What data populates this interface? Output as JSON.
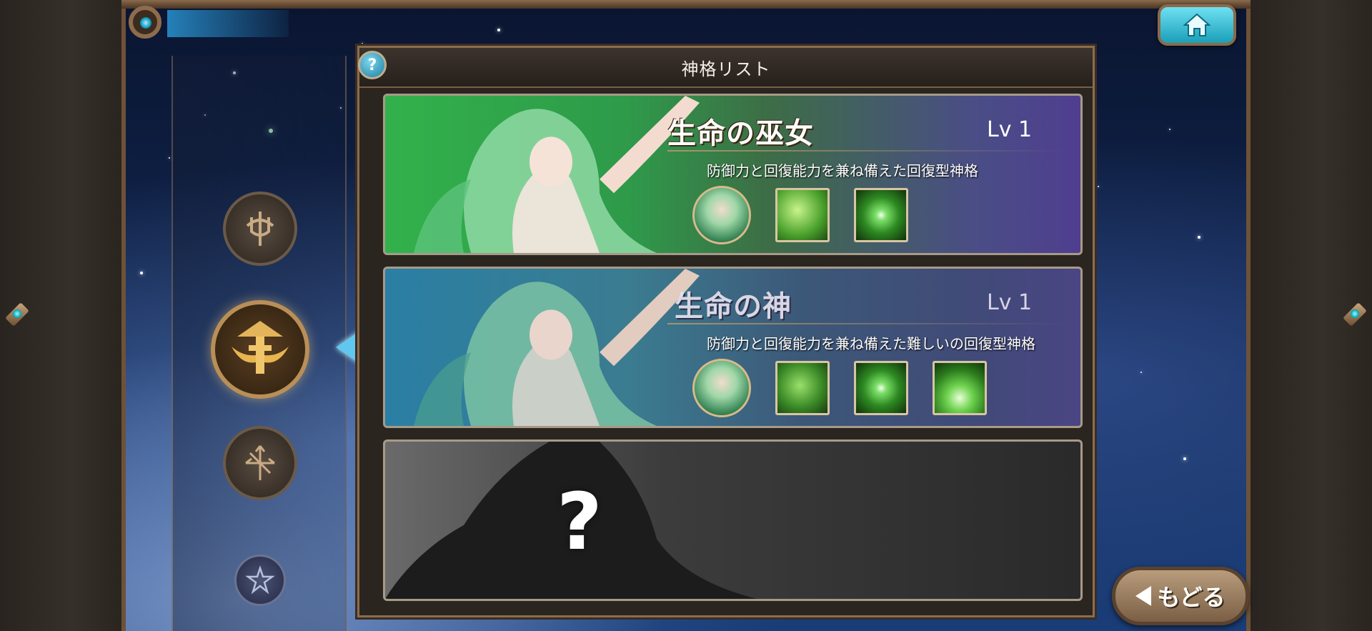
{
  "screen": {
    "title": "神格リスト",
    "help_label": "?"
  },
  "header": {
    "home_icon": "home-icon"
  },
  "nav": {
    "items": [
      {
        "icon": "trident-emblem-icon",
        "active": false
      },
      {
        "icon": "winged-cross-emblem-icon",
        "active": true
      },
      {
        "icon": "arrows-emblem-icon",
        "active": false
      },
      {
        "icon": "star-emblem-icon",
        "active": false
      }
    ]
  },
  "list": {
    "cards": [
      {
        "name": "生命の巫女",
        "level": "Lv 1",
        "description": "防御力と回復能力を兼ね備えた回復型神格",
        "icons": [
          "character-portrait-icon",
          "leaf-drop-skill-icon",
          "green-glow-skill-icon"
        ],
        "colors": {
          "accent": "#32b14b"
        }
      },
      {
        "name": "生命の神",
        "level": "Lv 1",
        "description": "防御力と回復能力を兼ね備えた難しいの回復型神格",
        "icons": [
          "character-portrait-icon",
          "green-vine-skill-icon",
          "green-glow-skill-icon",
          "green-light-skill-icon"
        ],
        "colors": {
          "accent": "#2a7fa4"
        }
      },
      {
        "locked": true,
        "mystery": "?"
      }
    ]
  },
  "footer": {
    "back_label": "もどる"
  }
}
